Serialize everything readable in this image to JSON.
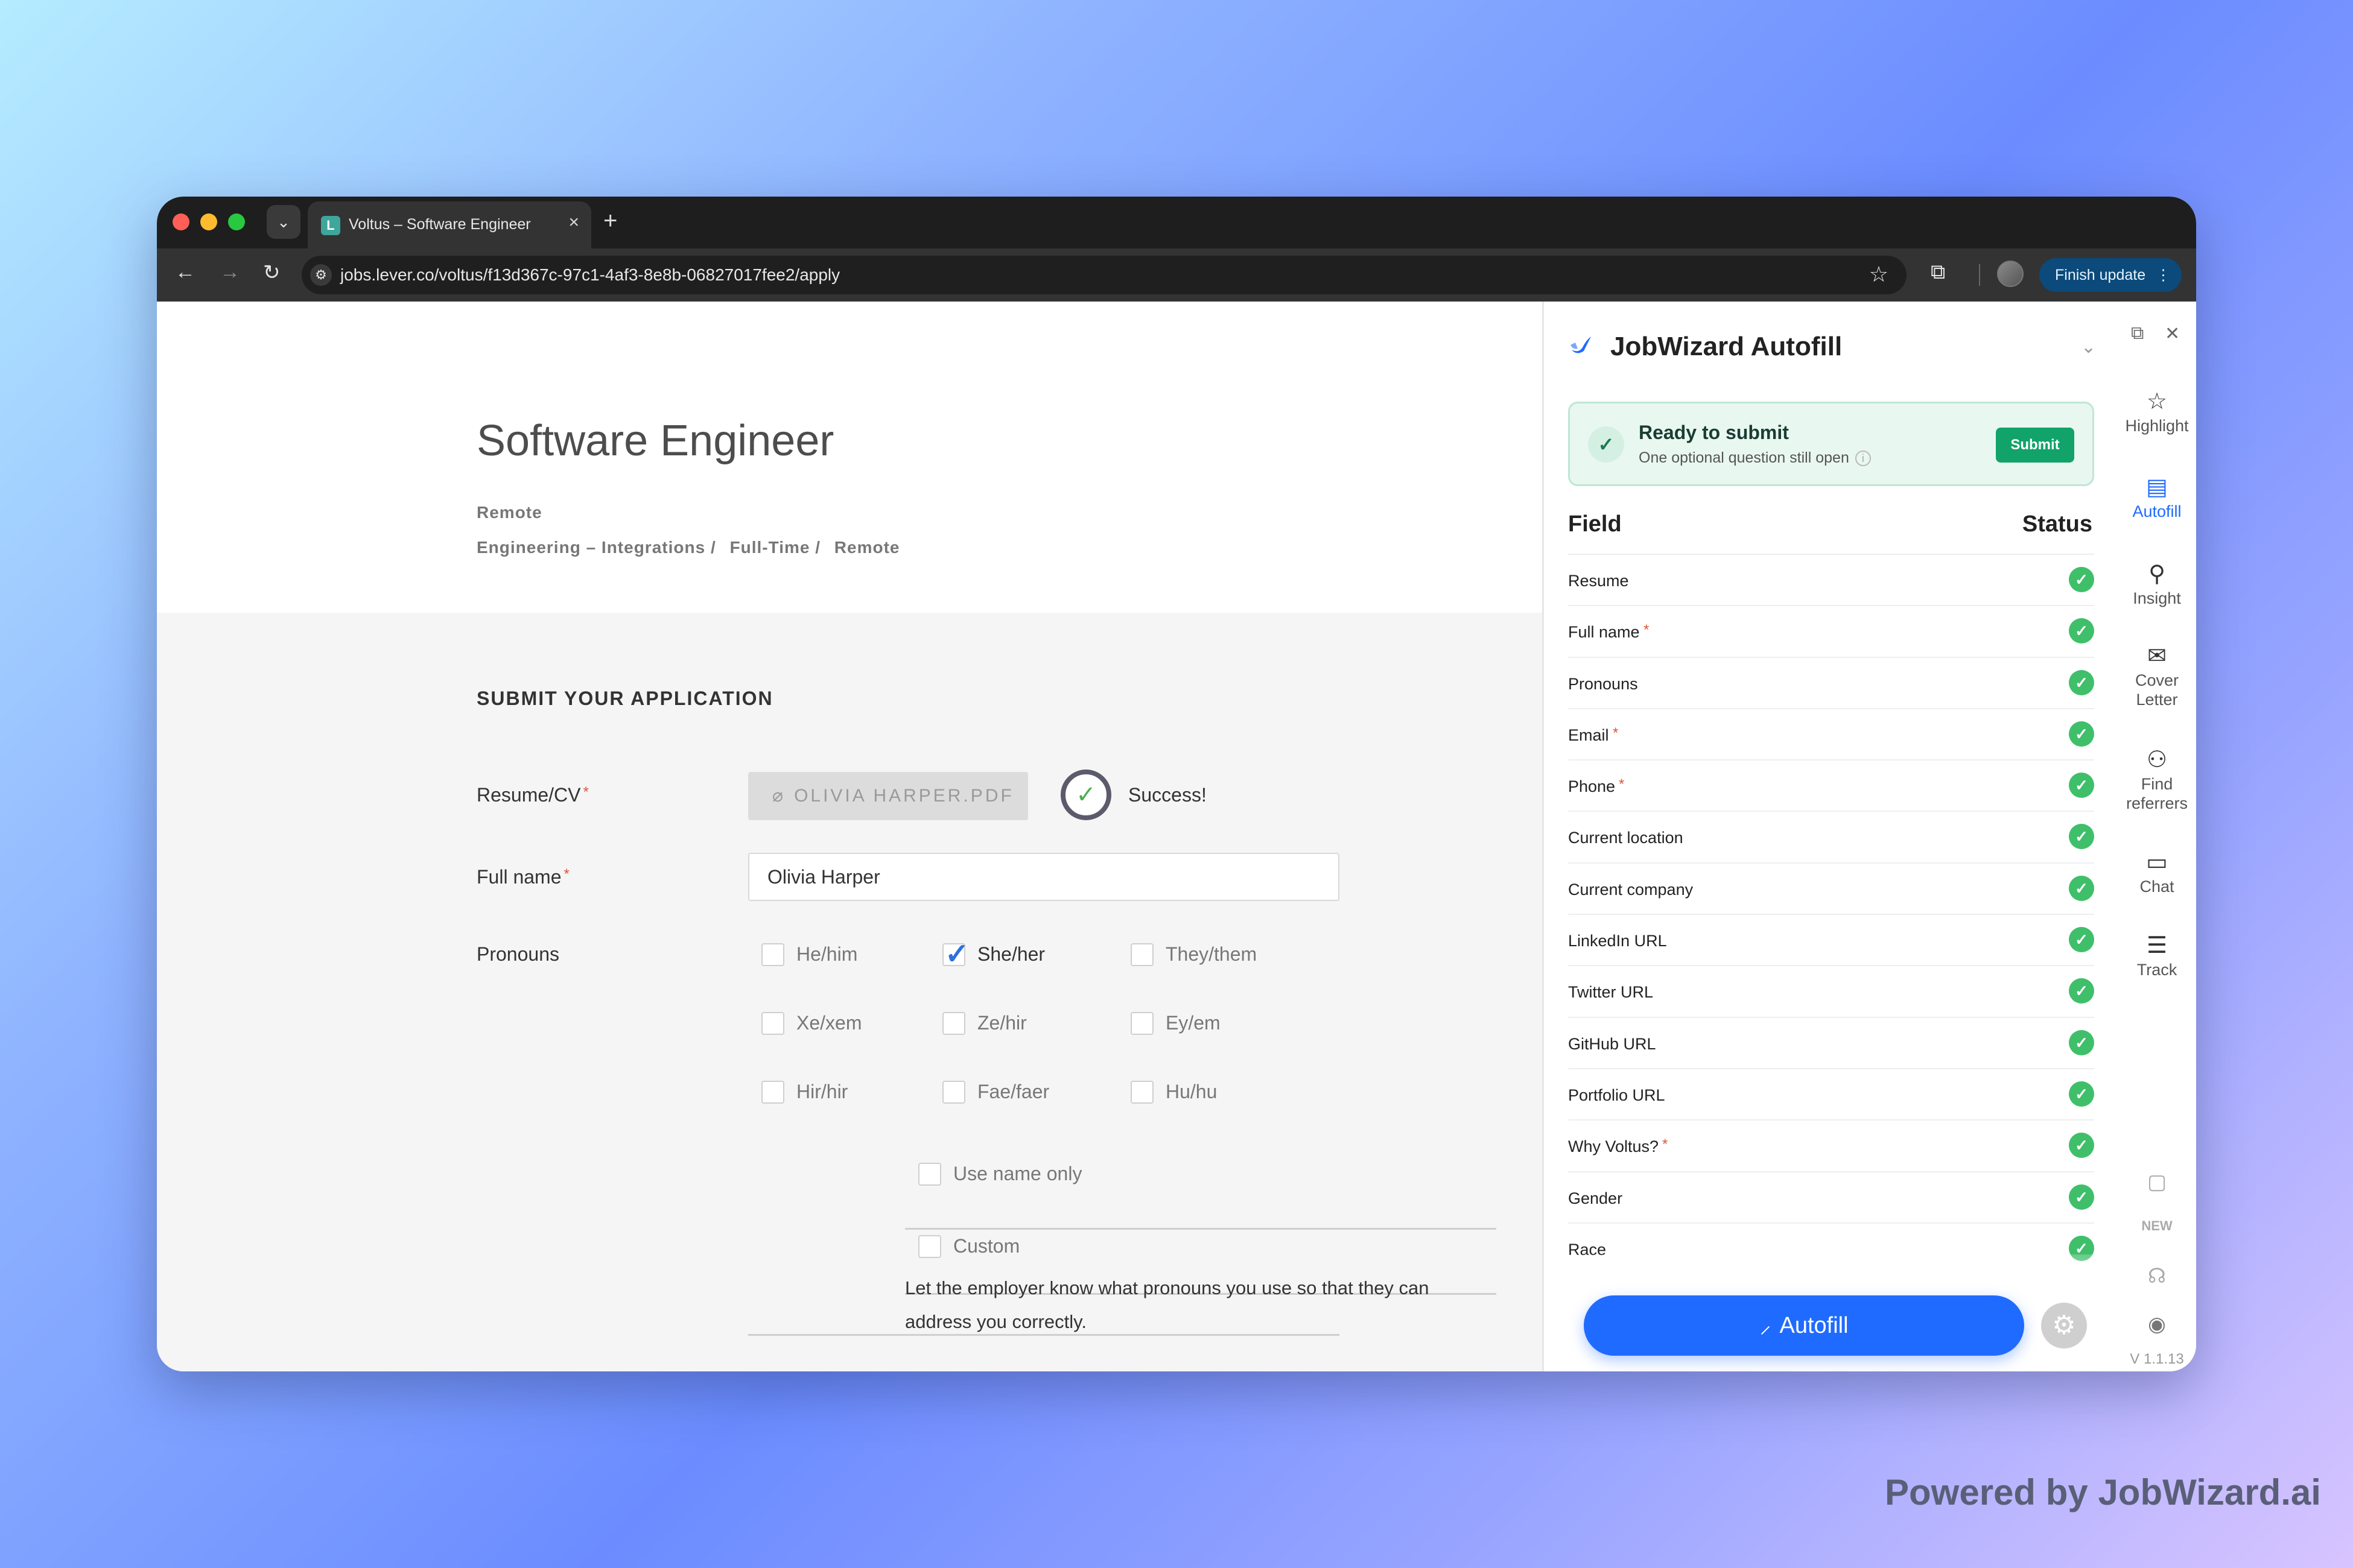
{
  "browser": {
    "tab_title": "Voltus – Software Engineer",
    "tab_favicon": "L",
    "url": "jobs.lever.co/voltus/f13d367c-97c1-4af3-8e8b-06827017fee2/apply",
    "finish_update": "Finish update"
  },
  "job": {
    "title": "Software Engineer",
    "location": "Remote",
    "meta": [
      "Engineering – Integrations /",
      "Full-Time /",
      "Remote"
    ]
  },
  "form": {
    "section_title": "SUBMIT YOUR APPLICATION",
    "resume_label": "Resume/CV",
    "resume_file": "OLIVIA HARPER.PDF",
    "success_text": "Success!",
    "fullname_label": "Full name",
    "fullname_value": "Olivia Harper",
    "pronouns_label": "Pronouns",
    "pronouns": [
      "He/him",
      "She/her",
      "They/them",
      "Xe/xem",
      "Ze/hir",
      "Ey/em",
      "Hir/hir",
      "Fae/faer",
      "Hu/hu"
    ],
    "pronoun_selected": "She/her",
    "use_name_only": "Use name only",
    "custom": "Custom",
    "help_text": "Let the employer know what pronouns you use so that they can address you correctly.",
    "required_mark": "*"
  },
  "jobwizard": {
    "title": "JobWizard Autofill",
    "ready_title": "Ready to submit",
    "ready_sub": "One optional question still open",
    "submit_label": "Submit",
    "col_field": "Field",
    "col_status": "Status",
    "fields": [
      {
        "name": "Resume",
        "required": false
      },
      {
        "name": "Full name",
        "required": true
      },
      {
        "name": "Pronouns",
        "required": false
      },
      {
        "name": "Email",
        "required": true
      },
      {
        "name": "Phone",
        "required": true
      },
      {
        "name": "Current location",
        "required": false
      },
      {
        "name": "Current company",
        "required": false
      },
      {
        "name": "LinkedIn URL",
        "required": false
      },
      {
        "name": "Twitter URL",
        "required": false
      },
      {
        "name": "GitHub URL",
        "required": false
      },
      {
        "name": "Portfolio URL",
        "required": false
      },
      {
        "name": "Why Voltus?",
        "required": true
      },
      {
        "name": "Gender",
        "required": false
      },
      {
        "name": "Race",
        "required": false
      }
    ],
    "autofill_label": "Autofill",
    "status_color": "#3fbf6a",
    "accent_color": "#1f6bff"
  },
  "rail": {
    "items": [
      "Highlight",
      "Autofill",
      "Insight",
      "Cover Letter",
      "Find referrers",
      "Chat",
      "Track"
    ],
    "active": "Autofill",
    "version": "V 1.1.13"
  },
  "footer": {
    "powered_by": "Powered by JobWizard.ai"
  }
}
